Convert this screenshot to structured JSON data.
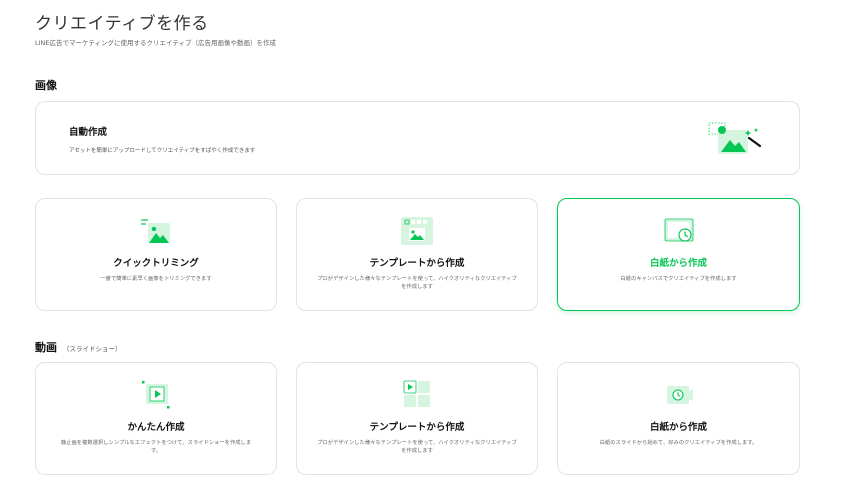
{
  "header": {
    "title": "クリエイティブを作る",
    "subtitle": "LINE広告でマーケティングに使用するクリエイティブ（広告用画像や動画）を作成"
  },
  "image_section": {
    "title": "画像",
    "auto": {
      "title": "自動作成",
      "desc": "アセットを簡単にアップロードしてクリエイティブをすばやく作成できます",
      "icon": "auto-image-magic-icon"
    },
    "cards": [
      {
        "title": "クイックトリミング",
        "desc": "一度で簡単に素早く画像をトリミングできます",
        "icon": "quick-trim-icon"
      },
      {
        "title": "テンプレートから作成",
        "desc": "プロがデザインした様々なテンプレートを使って、ハイクオリティなクリエイティブを作成します",
        "icon": "template-image-icon"
      },
      {
        "title": "白紙から作成",
        "desc": "白紙のキャンバスでクリエイティブを作成します",
        "icon": "blank-canvas-icon",
        "selected": true
      }
    ]
  },
  "video_section": {
    "title": "動画",
    "subtitle": "（スライドショー）",
    "cards": [
      {
        "title": "かんたん作成",
        "desc": "静止画を複数選択しシンプルなエフェクトをつけて、スライドショーを作成します。",
        "icon": "easy-slideshow-icon"
      },
      {
        "title": "テンプレートから作成",
        "desc": "プロがデザインした様々なテンプレートを使って、ハイクオリティなクリエイティブを作成します",
        "icon": "template-video-icon"
      },
      {
        "title": "白紙から作成",
        "desc": "白紙のスライドから始めて、好みのクリエイティブを作成します。",
        "icon": "blank-slide-icon"
      }
    ]
  },
  "colors": {
    "accent": "#06c755",
    "light_green": "#d6f5e1",
    "border": "#e3e3e3"
  }
}
